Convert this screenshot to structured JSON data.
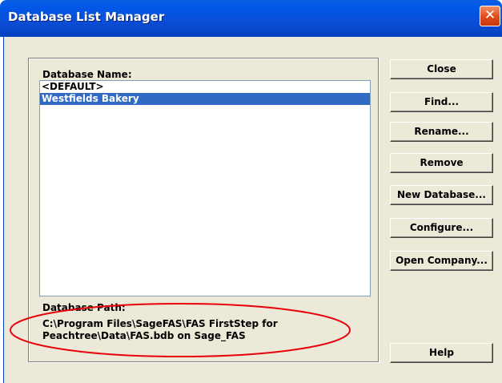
{
  "window": {
    "title": "Database List Manager",
    "close_glyph": "✕"
  },
  "list": {
    "label": "Database Name:",
    "items": [
      "<DEFAULT>",
      "Westfields Bakery"
    ],
    "selected_index": 1
  },
  "path": {
    "label": "Database Path:",
    "line1": "C:\\Program Files\\SageFAS\\FAS FirstStep for",
    "line2": "Peachtree\\Data\\FAS.bdb on Sage_FAS"
  },
  "buttons": {
    "close": "Close",
    "find": "Find...",
    "rename": "Rename...",
    "remove": "Remove",
    "new_database": "New Database...",
    "configure": "Configure...",
    "open_company": "Open Company...",
    "help": "Help"
  },
  "colors": {
    "title_bar": "#0058e8",
    "selection": "#316ac5",
    "annotation_ellipse": "#e8000b",
    "dialog_face": "#ece9d8"
  }
}
